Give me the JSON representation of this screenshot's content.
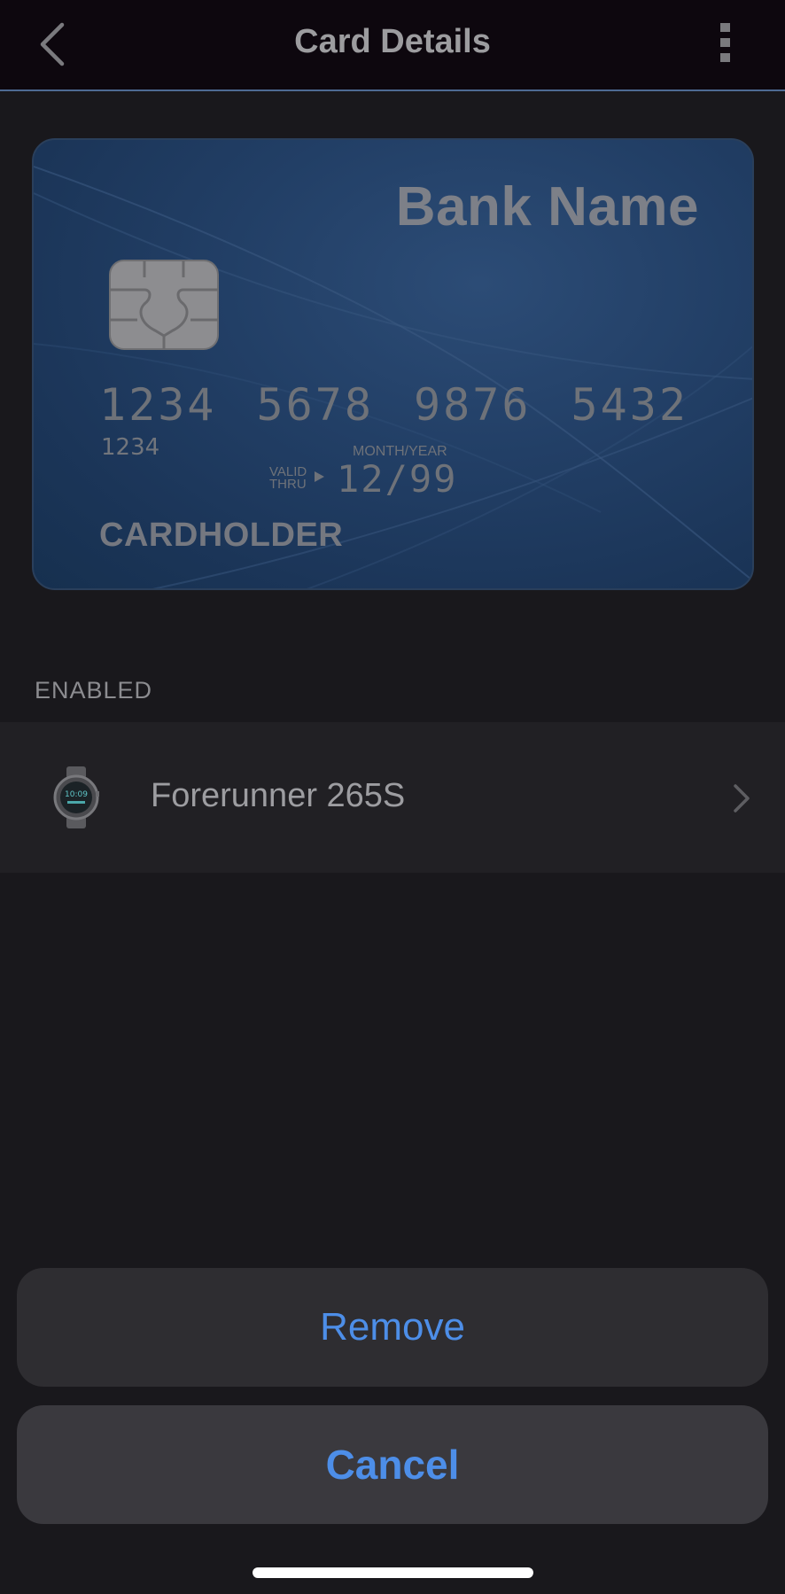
{
  "header": {
    "title": "Card Details",
    "back_icon": "chevron-left-icon",
    "more_icon": "more-vertical-icon"
  },
  "card": {
    "bank_name": "Bank Name",
    "number": "1234 5678 9876 5432",
    "number_small": "1234",
    "valid_thru_line1": "VALID",
    "valid_thru_line2": "THRU",
    "month_year_label": "MONTH/YEAR",
    "expiry": "12/99",
    "cardholder": "CARDHOLDER",
    "chip_icon": "emv-chip-icon"
  },
  "section": {
    "label": "ENABLED"
  },
  "devices": [
    {
      "name": "Forerunner 265S",
      "icon": "smartwatch-icon"
    }
  ],
  "actions": {
    "remove_label": "Remove",
    "cancel_label": "Cancel"
  },
  "colors": {
    "accent": "#4d8ee8",
    "background": "#19181c",
    "header_bg": "#0d070e",
    "card_blue": "#223f66"
  }
}
